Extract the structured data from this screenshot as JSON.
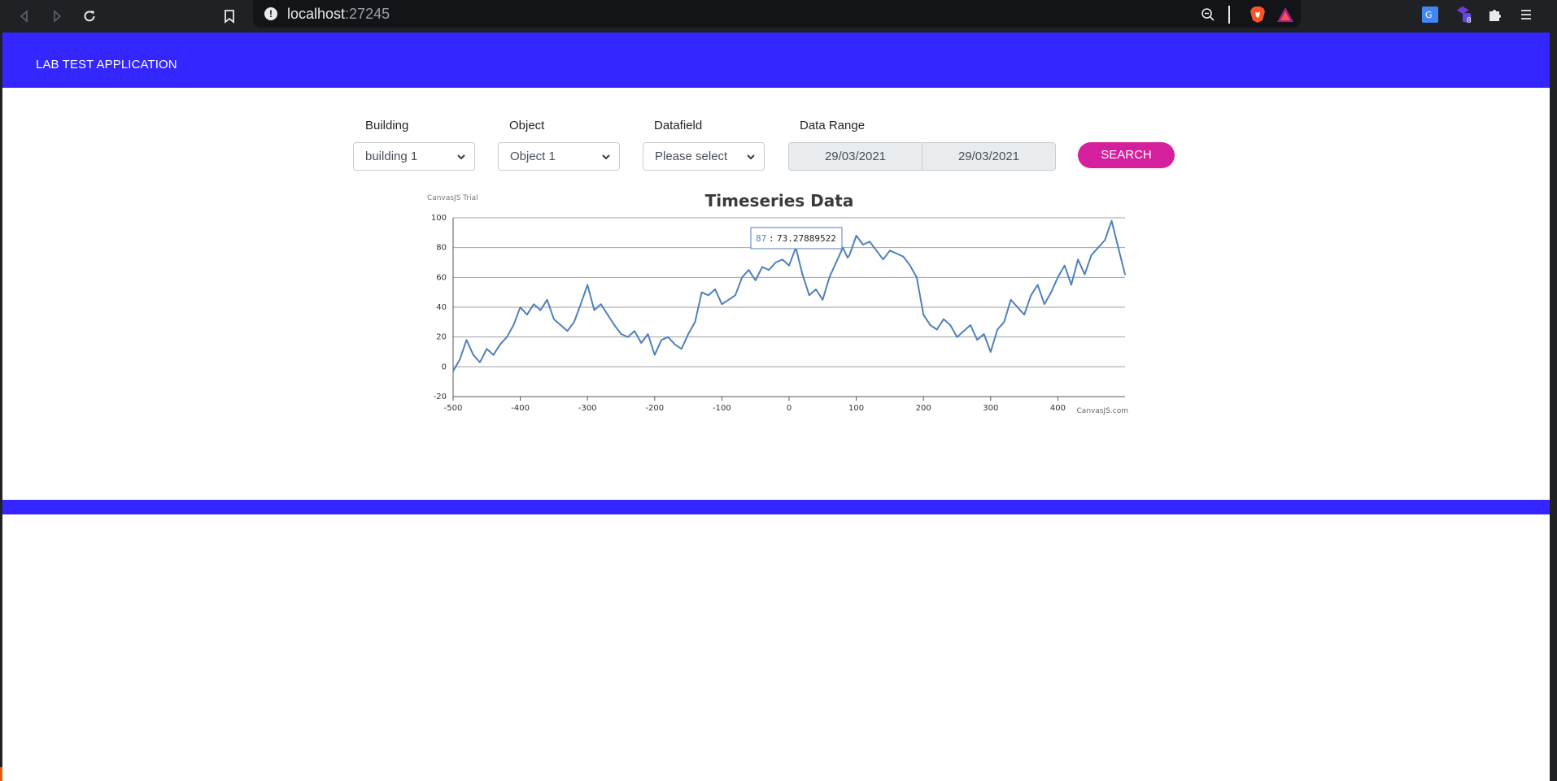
{
  "browser": {
    "url_host": "localhost",
    "url_port": ":27245",
    "extension_badge": "8"
  },
  "app": {
    "title": "LAB TEST APPLICATION"
  },
  "filters": {
    "building": {
      "label": "Building",
      "value": "building 1"
    },
    "object": {
      "label": "Object",
      "value": "Object 1"
    },
    "datafield": {
      "label": "Datafield",
      "value": "Please select"
    },
    "date_range": {
      "label": "Data Range",
      "from": "29/03/2021",
      "to": "29/03/2021"
    },
    "search_label": "SEARCH"
  },
  "chart_data": {
    "type": "line",
    "title": "Timeseries Data",
    "trial_text": "CanvasJS Trial",
    "credit": "CanvasJS.com",
    "xlim": [
      -500,
      500
    ],
    "ylim": [
      -20,
      100
    ],
    "x_ticks": [
      -500,
      -400,
      -300,
      -200,
      -100,
      0,
      100,
      200,
      300,
      400
    ],
    "y_ticks": [
      -20,
      0,
      20,
      40,
      60,
      80,
      100
    ],
    "grid": true,
    "color": "#4f81bc",
    "series": [
      {
        "points": [
          [
            -500,
            -3
          ],
          [
            -490,
            5
          ],
          [
            -480,
            18
          ],
          [
            -470,
            8
          ],
          [
            -460,
            3
          ],
          [
            -450,
            12
          ],
          [
            -440,
            8
          ],
          [
            -430,
            15
          ],
          [
            -420,
            20
          ],
          [
            -410,
            28
          ],
          [
            -400,
            40
          ],
          [
            -390,
            35
          ],
          [
            -380,
            42
          ],
          [
            -370,
            38
          ],
          [
            -360,
            45
          ],
          [
            -350,
            32
          ],
          [
            -340,
            28
          ],
          [
            -330,
            24
          ],
          [
            -320,
            30
          ],
          [
            -310,
            42
          ],
          [
            -300,
            55
          ],
          [
            -290,
            38
          ],
          [
            -280,
            42
          ],
          [
            -270,
            35
          ],
          [
            -260,
            28
          ],
          [
            -250,
            22
          ],
          [
            -240,
            20
          ],
          [
            -230,
            24
          ],
          [
            -220,
            16
          ],
          [
            -210,
            22
          ],
          [
            -200,
            8
          ],
          [
            -190,
            18
          ],
          [
            -180,
            20
          ],
          [
            -170,
            15
          ],
          [
            -160,
            12
          ],
          [
            -150,
            22
          ],
          [
            -140,
            30
          ],
          [
            -130,
            50
          ],
          [
            -120,
            48
          ],
          [
            -110,
            52
          ],
          [
            -100,
            42
          ],
          [
            -90,
            45
          ],
          [
            -80,
            48
          ],
          [
            -70,
            60
          ],
          [
            -60,
            65
          ],
          [
            -50,
            58
          ],
          [
            -40,
            67
          ],
          [
            -30,
            65
          ],
          [
            -20,
            70
          ],
          [
            -10,
            72
          ],
          [
            0,
            68
          ],
          [
            10,
            80
          ],
          [
            20,
            62
          ],
          [
            30,
            48
          ],
          [
            40,
            52
          ],
          [
            50,
            45
          ],
          [
            60,
            60
          ],
          [
            70,
            70
          ],
          [
            80,
            80
          ],
          [
            87,
            73.27889522
          ],
          [
            90,
            75
          ],
          [
            100,
            88
          ],
          [
            110,
            82
          ],
          [
            120,
            84
          ],
          [
            130,
            78
          ],
          [
            140,
            72
          ],
          [
            150,
            78
          ],
          [
            160,
            76
          ],
          [
            170,
            74
          ],
          [
            180,
            68
          ],
          [
            190,
            60
          ],
          [
            200,
            35
          ],
          [
            210,
            28
          ],
          [
            220,
            25
          ],
          [
            230,
            32
          ],
          [
            240,
            28
          ],
          [
            250,
            20
          ],
          [
            260,
            24
          ],
          [
            270,
            28
          ],
          [
            280,
            18
          ],
          [
            290,
            22
          ],
          [
            300,
            10
          ],
          [
            310,
            25
          ],
          [
            320,
            30
          ],
          [
            330,
            45
          ],
          [
            340,
            40
          ],
          [
            350,
            35
          ],
          [
            360,
            48
          ],
          [
            370,
            55
          ],
          [
            380,
            42
          ],
          [
            390,
            50
          ],
          [
            400,
            60
          ],
          [
            410,
            68
          ],
          [
            420,
            55
          ],
          [
            430,
            72
          ],
          [
            440,
            62
          ],
          [
            450,
            75
          ],
          [
            460,
            80
          ],
          [
            470,
            85
          ],
          [
            480,
            98
          ],
          [
            490,
            80
          ],
          [
            500,
            62
          ]
        ]
      }
    ],
    "tooltip": {
      "x": "87",
      "separator": ":",
      "value": "73.27889522"
    }
  }
}
